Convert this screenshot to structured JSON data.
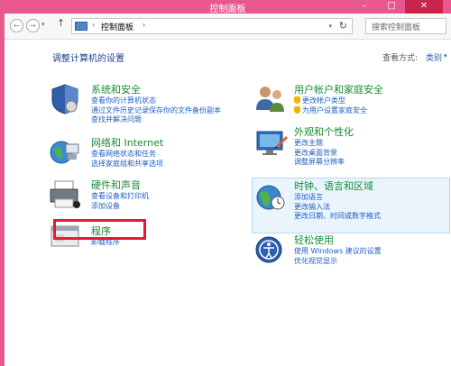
{
  "window": {
    "title": "控制面板",
    "controls": {
      "minimize": "–",
      "maximize": "□",
      "close": "✕"
    }
  },
  "nav": {
    "back": "←",
    "forward": "→",
    "dropdown": "▾",
    "up": "↑",
    "address": "控制面板",
    "address_sep": "›",
    "address_dropdown": "▾",
    "refresh": "↻",
    "search_placeholder": "搜索控制面板"
  },
  "heading": "调整计算机的设置",
  "view": {
    "label": "查看方式:",
    "value": "类别",
    "dropdown": "▾"
  },
  "categories": {
    "system": {
      "title": "系统和安全",
      "links": [
        "查看你的计算机状态",
        "通过文件历史记录保存你的文件备份副本",
        "查找并解决问题"
      ]
    },
    "network": {
      "title": "网络和 Internet",
      "links": [
        "查看网络状态和任务",
        "选择家庭组和共享选项"
      ]
    },
    "hardware": {
      "title": "硬件和声音",
      "links": [
        "查看设备和打印机",
        "添加设备"
      ]
    },
    "programs": {
      "title": "程序",
      "links": [
        "卸载程序"
      ]
    },
    "users": {
      "title": "用户帐户和家庭安全",
      "links": [
        "更改帐户类型",
        "为用户设置家庭安全"
      ]
    },
    "appearance": {
      "title": "外观和个性化",
      "links": [
        "更改主题",
        "更改桌面背景",
        "调整屏幕分辨率"
      ]
    },
    "clock": {
      "title": "时钟、语言和区域",
      "links": [
        "添加语言",
        "更改输入法",
        "更改日期、时间或数字格式"
      ]
    },
    "ease": {
      "title": "轻松使用",
      "links": [
        "使用 Windows 建议的设置",
        "优化视觉显示"
      ]
    }
  },
  "colors": {
    "accent": "#e8588f",
    "category": "#1a8a3a",
    "link": "#1e5fc0",
    "heading": "#1e3e8c",
    "annotation": "#e8192e"
  }
}
